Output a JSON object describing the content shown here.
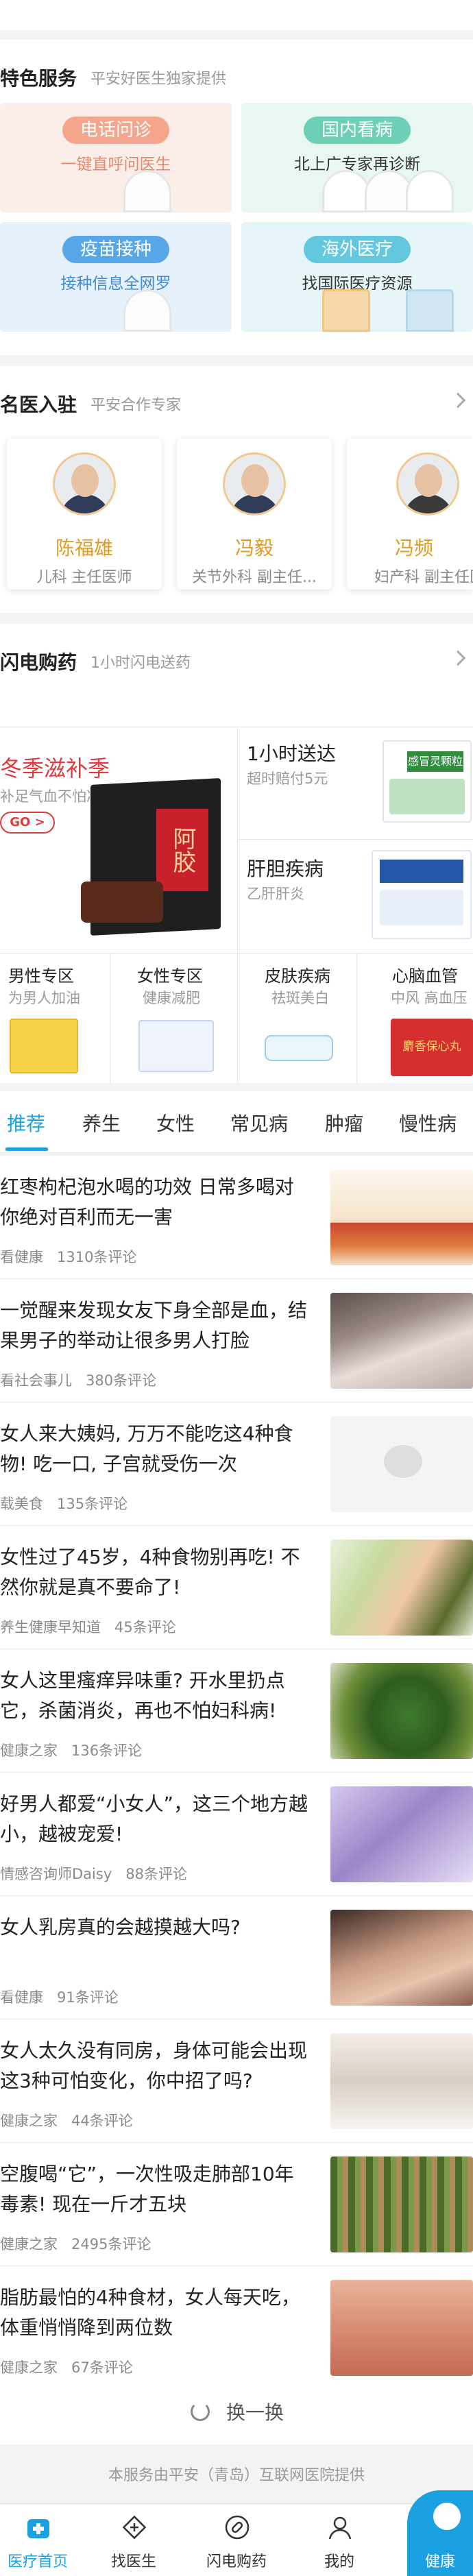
{
  "special": {
    "title": "特色服务",
    "subtitle": "平安好医生独家提供",
    "items": [
      {
        "label": "电话问诊",
        "desc": "一键直呼问医生",
        "pill": "#f4a58b",
        "bg": "#fbeee9",
        "text": "#e3886e"
      },
      {
        "label": "国内看病",
        "desc": "北上广专家再诊断",
        "pill": "#6dd0b6",
        "bg": "#e8f7f2",
        "text": "#333333"
      },
      {
        "label": "疫苗接种",
        "desc": "接种信息全网罗",
        "pill": "#57a6e8",
        "bg": "#e6f1fb",
        "text": "#3e8ad6"
      },
      {
        "label": "海外医疗",
        "desc": "找国际医疗资源",
        "pill": "#63c8de",
        "bg": "#e5f5f8",
        "text": "#333333"
      }
    ]
  },
  "doctors": {
    "title": "名医入驻",
    "subtitle": "平安合作专家",
    "items": [
      {
        "name": "陈福雄",
        "desc": "儿科 主任医师"
      },
      {
        "name": "冯毅",
        "desc": "关节外科 副主任..."
      },
      {
        "name": "冯频",
        "desc": "妇产科 副主任医"
      }
    ]
  },
  "pharmacy": {
    "title": "闪电购药",
    "subtitle": "1小时闪电送药",
    "promo_title": "冬季滋补季",
    "promo_sub": "补足气血不怕冷",
    "promo_go": "GO >",
    "promo_box_text": "阿胶",
    "delivery_title": "1小时送达",
    "delivery_sub": "超时赔付5元",
    "delivery_box_text": "感冒灵颗粒",
    "liver_title": "肝胆疾病",
    "liver_sub": "乙肝肝炎",
    "cats": [
      {
        "title": "男性专区",
        "sub": "为男人加油"
      },
      {
        "title": "女性专区",
        "sub": "健康减肥"
      },
      {
        "title": "皮肤疾病",
        "sub": "祛斑美白"
      },
      {
        "title": "心脑血管",
        "sub": "中风 高血压"
      }
    ],
    "heart_box_text": "麝香保心丸"
  },
  "tabs": [
    "推荐",
    "养生",
    "女性",
    "常见病",
    "肿瘤",
    "慢性病"
  ],
  "articles": [
    {
      "title": "红枣枸杞泡水喝的功效 日常多喝对你绝对百利而无一害",
      "source": "看健康",
      "comments": "1310条评论"
    },
    {
      "title": "一觉醒来发现女友下身全部是血，结果男子的举动让很多男人打脸",
      "source": "看社会事儿",
      "comments": "380条评论"
    },
    {
      "title": "女人来大姨妈, 万万不能吃这4种食物! 吃一口, 子宫就受伤一次",
      "source": "载美食",
      "comments": "135条评论"
    },
    {
      "title": "女性过了45岁，4种食物别再吃! 不然你就是真不要命了!",
      "source": "养生健康早知道",
      "comments": "45条评论"
    },
    {
      "title": "女人这里瘙痒异味重? 开水里扔点它，杀菌消炎，再也不怕妇科病!",
      "source": "健康之家",
      "comments": "136条评论"
    },
    {
      "title": "好男人都爱“小女人”，这三个地方越小，越被宠爱!",
      "source": "情感咨询师Daisy",
      "comments": "88条评论"
    },
    {
      "title": "女人乳房真的会越摸越大吗?",
      "source": "看健康",
      "comments": "91条评论"
    },
    {
      "title": "女人太久没有同房，身体可能会出现这3种可怕变化，你中招了吗?",
      "source": "健康之家",
      "comments": "44条评论"
    },
    {
      "title": "空腹喝“它”，一次性吸走肺部10年毒素! 现在一斤才五块",
      "source": "健康之家",
      "comments": "2495条评论"
    },
    {
      "title": "脂肪最怕的4种食材，女人每天吃，体重悄悄降到两位数",
      "source": "健康之家",
      "comments": "67条评论"
    }
  ],
  "refresh_label": "换一换",
  "provider_note": "本服务由平安（青岛）互联网医院提供",
  "tabbar": [
    {
      "label": "医疗首页",
      "active": true
    },
    {
      "label": "找医生",
      "active": false
    },
    {
      "label": "闪电购药",
      "active": false
    },
    {
      "label": "我的",
      "active": false
    }
  ],
  "fab_label": "健康",
  "colors": {
    "accent": "#1ba1e2",
    "doctor_name": "#e39a1e",
    "promo_red": "#e0393e"
  }
}
